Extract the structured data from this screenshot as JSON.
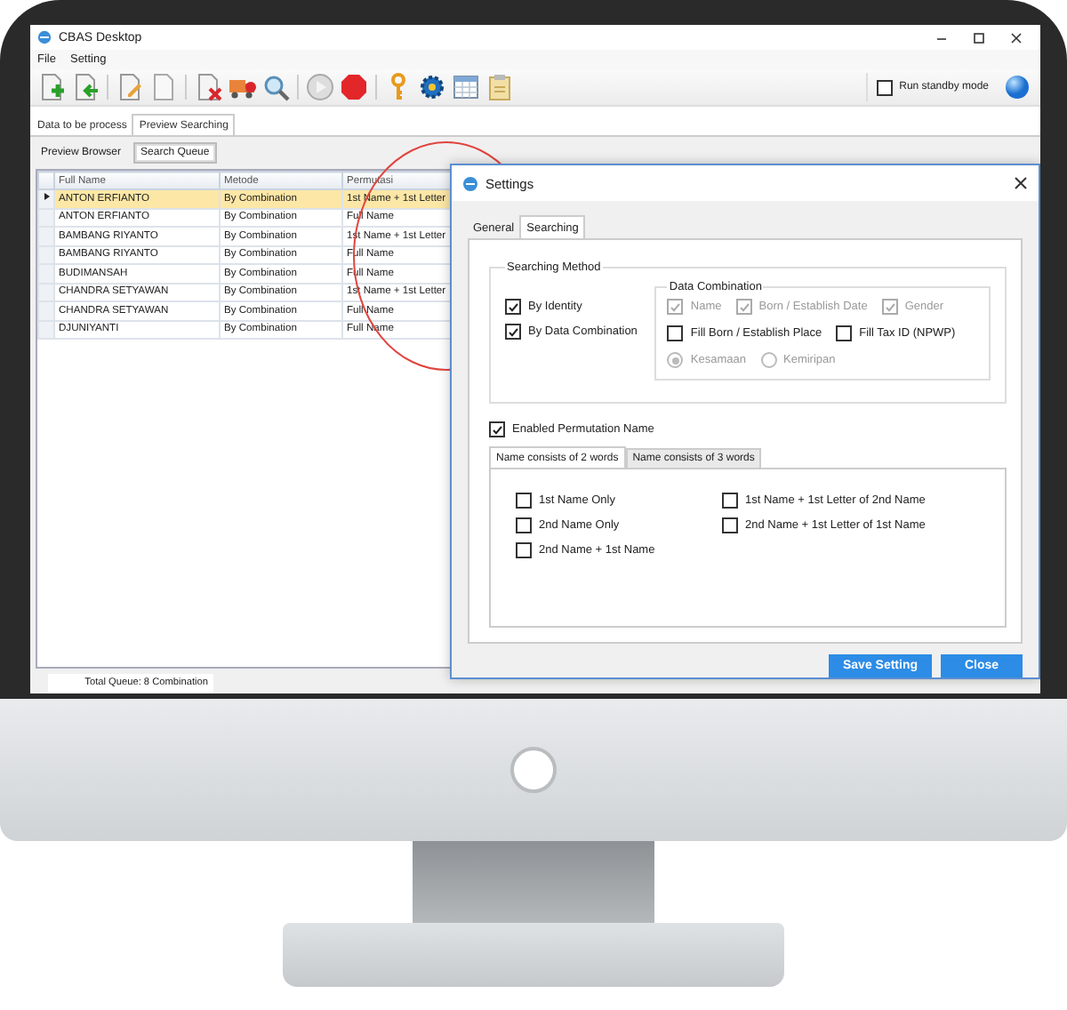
{
  "window": {
    "title": "CBAS Desktop"
  },
  "menu": [
    "File",
    "Setting"
  ],
  "standby": {
    "label": "Run standby mode",
    "checked": false
  },
  "tabs": [
    {
      "label": "Data to be process",
      "selected": false
    },
    {
      "label": "Preview Searching",
      "selected": true
    }
  ],
  "subtabs": [
    {
      "label": "Preview Browser",
      "selected": false
    },
    {
      "label": "Search Queue",
      "selected": true
    }
  ],
  "table": {
    "columns": [
      "Full Name",
      "Metode",
      "Permutasi"
    ],
    "rows": [
      {
        "cells": [
          "ANTON ERFIANTO",
          "By Combination",
          "1st Name + 1st Letter"
        ],
        "selected": true
      },
      {
        "cells": [
          "ANTON ERFIANTO",
          "By Combination",
          "Full Name"
        ],
        "selected": false
      },
      {
        "cells": [
          "BAMBANG RIYANTO",
          "By Combination",
          "1st Name + 1st Letter"
        ],
        "selected": false
      },
      {
        "cells": [
          "BAMBANG RIYANTO",
          "By Combination",
          "Full Name"
        ],
        "selected": false
      },
      {
        "cells": [
          "BUDIMANSAH",
          "By Combination",
          "Full Name"
        ],
        "selected": false
      },
      {
        "cells": [
          "CHANDRA SETYAWAN",
          "By Combination",
          "1st Name + 1st Letter"
        ],
        "selected": false
      },
      {
        "cells": [
          "CHANDRA SETYAWAN",
          "By Combination",
          "Full Name"
        ],
        "selected": false
      },
      {
        "cells": [
          "DJUNIYANTI",
          "By Combination",
          "Full Name"
        ],
        "selected": false
      }
    ]
  },
  "status_bar": {
    "total": "Total Queue: 8 Combination"
  },
  "dialog": {
    "title": "Settings",
    "tabs": [
      {
        "label": "General",
        "selected": false
      },
      {
        "label": "Searching",
        "selected": true
      }
    ],
    "searching_method": {
      "title": "Searching Method",
      "options": [
        {
          "label": "By Identity",
          "checked": true
        },
        {
          "label": "By Data Combination",
          "checked": true
        }
      ]
    },
    "data_combination": {
      "title": "Data Combination",
      "options": [
        {
          "label": "Name",
          "checked": true,
          "disabled": true
        },
        {
          "label": "Born / Establish Date",
          "checked": true,
          "disabled": true
        },
        {
          "label": "Gender",
          "checked": true,
          "disabled": true
        },
        {
          "label": "Fill Born / Establish Place",
          "checked": false,
          "disabled": false
        },
        {
          "label": "Fill Tax ID (NPWP)",
          "checked": false,
          "disabled": false
        }
      ],
      "radios": [
        {
          "label": "Kesamaan",
          "selected": true,
          "disabled": true
        },
        {
          "label": "Kemiripan",
          "selected": false,
          "disabled": true
        }
      ]
    },
    "permutation": {
      "label": "Enabled Permutation Name",
      "checked": true
    },
    "name_tabs": [
      {
        "label": "Name consists of 2 words",
        "selected": true
      },
      {
        "label": "Name consists of 3 words",
        "selected": false
      }
    ],
    "name_options": [
      {
        "label": "1st Name Only",
        "checked": false
      },
      {
        "label": "2nd Name Only",
        "checked": false
      },
      {
        "label": "2nd Name + 1st Name",
        "checked": false
      },
      {
        "label": "1st Name + 1st Letter of 2nd Name",
        "checked": false
      },
      {
        "label": "2nd Name + 1st Letter of 1st Name",
        "checked": false
      }
    ],
    "buttons": [
      "Save Setting",
      "Close"
    ]
  }
}
